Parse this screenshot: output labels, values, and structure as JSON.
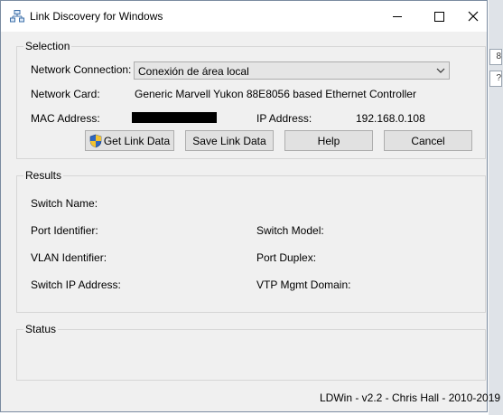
{
  "window": {
    "title": "Link Discovery for Windows"
  },
  "selection": {
    "group_label": "Selection",
    "network_connection_label": "Network Connection:",
    "network_connection_value": "Conexión de área local",
    "network_card_label": "Network Card:",
    "network_card_value": "Generic Marvell Yukon 88E8056 based Ethernet Controller",
    "mac_address_label": "MAC Address:",
    "ip_address_label": "IP Address:",
    "ip_address_value": "192.168.0.108",
    "buttons": {
      "get_link_data": "Get Link Data",
      "save_link_data": "Save Link Data",
      "help": "Help",
      "cancel": "Cancel"
    }
  },
  "results": {
    "group_label": "Results",
    "switch_name_label": "Switch Name:",
    "port_identifier_label": "Port Identifier:",
    "switch_model_label": "Switch Model:",
    "vlan_identifier_label": "VLAN Identifier:",
    "port_duplex_label": "Port Duplex:",
    "switch_ip_label": "Switch IP Address:",
    "vtp_domain_label": "VTP Mgmt Domain:"
  },
  "status": {
    "group_label": "Status"
  },
  "footer": {
    "version_text": "LDWin - v2.2 - Chris Hall - 2010-2019"
  },
  "backdrop": {
    "fragment_1": "8",
    "fragment_2": "?"
  },
  "icons": {
    "app": "network-icon",
    "shield": "uac-shield-icon",
    "dropdown": "chevron-down-icon"
  }
}
